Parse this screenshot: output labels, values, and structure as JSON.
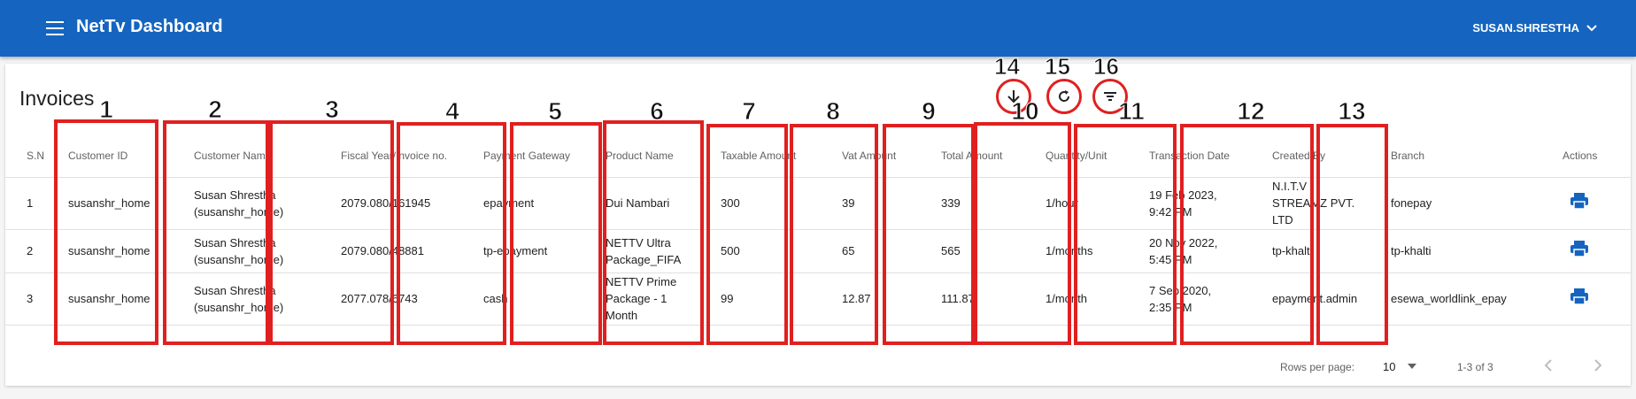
{
  "app": {
    "title": "NetTv Dashboard",
    "user": "SUSAN.SHRESTHA"
  },
  "page": {
    "title": "Invoices"
  },
  "toolbar": [
    {
      "num": "14",
      "icon": "download-icon"
    },
    {
      "num": "15",
      "icon": "refresh-icon"
    },
    {
      "num": "16",
      "icon": "filter-icon"
    }
  ],
  "columns": [
    {
      "label": "S.N",
      "num": ""
    },
    {
      "label": "Customer ID",
      "num": "1"
    },
    {
      "label": "Customer Name",
      "num": "2"
    },
    {
      "label": "Fiscal Year/Invoice no.",
      "num": "3"
    },
    {
      "label": "Payment Gateway",
      "num": "4"
    },
    {
      "label": "Product Name",
      "num": "5"
    },
    {
      "label": "Taxable Amount",
      "num": "6"
    },
    {
      "label": "Vat Amount",
      "num": "7"
    },
    {
      "label": "Total Amount",
      "num": "8"
    },
    {
      "label": "Quantity/Unit",
      "num": "9"
    },
    {
      "label": "Transaction Date",
      "num": "10"
    },
    {
      "label": "Created By",
      "num": "11"
    },
    {
      "label": "Branch",
      "num": "12"
    },
    {
      "label": "Actions",
      "num": "13"
    }
  ],
  "rows": [
    {
      "sn": "1",
      "customer_id": "susanshr_home",
      "customer_name": [
        "Susan Shrestha",
        "(susanshr_home)"
      ],
      "invoice": "2079.080/161945",
      "gateway": "epayment",
      "product": [
        "Dui Nambari"
      ],
      "taxable": "300",
      "vat": "39",
      "total": "339",
      "qty": "1/hour",
      "date": [
        "19 Feb 2023,",
        "9:42 PM"
      ],
      "created_by": [
        "N.I.T.V",
        "STREAMZ PVT.",
        "LTD"
      ],
      "branch": "fonepay"
    },
    {
      "sn": "2",
      "customer_id": "susanshr_home",
      "customer_name": [
        "Susan Shrestha",
        "(susanshr_home)"
      ],
      "invoice": "2079.080/48881",
      "gateway": "tp-epayment",
      "product": [
        "NETTV Ultra",
        "Package_FIFA"
      ],
      "taxable": "500",
      "vat": "65",
      "total": "565",
      "qty": "1/months",
      "date": [
        "20 Nov 2022,",
        "5:45 PM"
      ],
      "created_by": [
        "tp-khalti"
      ],
      "branch": "tp-khalti"
    },
    {
      "sn": "3",
      "customer_id": "susanshr_home",
      "customer_name": [
        "Susan Shrestha",
        "(susanshr_home)"
      ],
      "invoice": "2077.078/6743",
      "gateway": "cash",
      "product": [
        "NETTV Prime",
        "Package - 1",
        "Month"
      ],
      "taxable": "99",
      "vat": "12.87",
      "total": "111.87",
      "qty": "1/month",
      "date": [
        "7 Sep 2020,",
        "2:35 PM"
      ],
      "created_by": [
        "epayment.admin"
      ],
      "branch": "esewa_worldlink_epay"
    }
  ],
  "pagination": {
    "rows_per_page_label": "Rows per page:",
    "rows_per_page": "10",
    "range": "1-3 of 3"
  },
  "colors": {
    "appbar": "#1565c0",
    "annotation": "#e02020",
    "action": "#1565c0"
  }
}
